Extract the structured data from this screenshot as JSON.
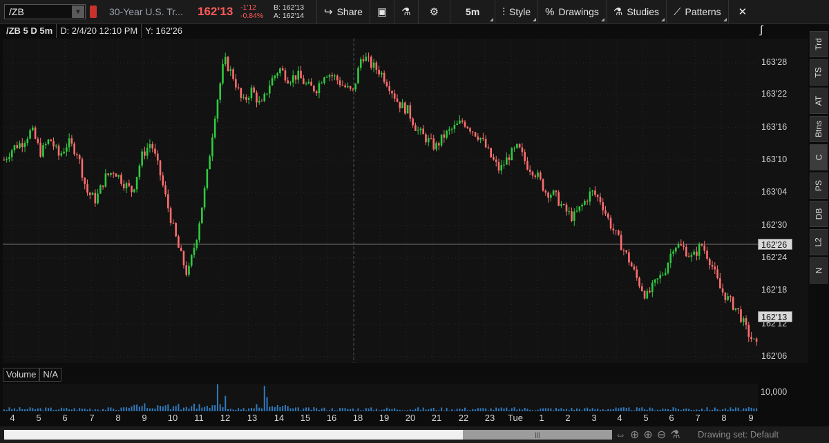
{
  "toolbar": {
    "symbol": "/ZB",
    "description": "30-Year U.S. Tr...",
    "last": "162'13",
    "change": "-1'12",
    "change_pct": "-0.84%",
    "bid": "B: 162'13",
    "ask": "A: 162'14",
    "share": "Share",
    "timeframe": "5m",
    "style": "Style",
    "drawings": "Drawings",
    "studies": "Studies",
    "patterns": "Patterns"
  },
  "chart_header": {
    "symbol_range": "/ZB 5 D 5m",
    "date": "D: 2/4/20 12:10 PM",
    "y": "Y: 162'26"
  },
  "price_axis": {
    "ticks": [
      "163'28",
      "163'22",
      "163'16",
      "163'10",
      "163'04",
      "162'30",
      "162'24",
      "162'18",
      "162'12",
      "162'06"
    ],
    "crosshair_label": "162'26",
    "last_label": "162'13"
  },
  "volume": {
    "label": "Volume",
    "value": "N/A",
    "tick": "10,000"
  },
  "time_axis": [
    "4",
    "5",
    "6",
    "7",
    "8",
    "9",
    "10",
    "11",
    "12",
    "13",
    "14",
    "15",
    "16",
    "18",
    "19",
    "20",
    "21",
    "22",
    "23",
    "Tue",
    "1",
    "2",
    "3",
    "4",
    "5",
    "6",
    "7",
    "8",
    "9"
  ],
  "right_tabs": [
    "Trd",
    "TS",
    "AT",
    "Btns",
    "C",
    "PS",
    "DB",
    "L2",
    "N"
  ],
  "drawing_set": "Drawing set: Default",
  "colors": {
    "up": "#2ecc40",
    "down": "#ff6e6e",
    "background": "#121212",
    "accent": "#ff5a5a"
  },
  "chart_data": {
    "type": "candlestick",
    "series_name": "/ZB 5 D 5m",
    "price_ticks": [
      "163'28",
      "163'22",
      "163'16",
      "163'10",
      "163'04",
      "162'30",
      "162'24",
      "162'18",
      "162'12",
      "162'06"
    ],
    "ylim": [
      162.125,
      163.96875
    ],
    "close_path": [
      163.28,
      163.35,
      163.38,
      163.45,
      163.32,
      163.4,
      163.3,
      163.38,
      163.32,
      163.1,
      163.05,
      163.18,
      163.22,
      163.15,
      163.1,
      163.3,
      163.38,
      163.2,
      162.98,
      162.78,
      162.62,
      162.85,
      163.15,
      163.55,
      163.85,
      163.75,
      163.6,
      163.68,
      163.58,
      163.72,
      163.8,
      163.74,
      163.76,
      163.7,
      163.68,
      163.78,
      163.75,
      163.7,
      163.66,
      163.88,
      163.82,
      163.78,
      163.7,
      163.6,
      163.56,
      163.45,
      163.4,
      163.35,
      163.42,
      163.46,
      163.5,
      163.45,
      163.4,
      163.3,
      163.22,
      163.3,
      163.35,
      163.25,
      163.2,
      163.1,
      163.08,
      163.0,
      162.95,
      163.02,
      163.1,
      163.05,
      162.92,
      162.82,
      162.72,
      162.6,
      162.5,
      162.58,
      162.65,
      162.8,
      162.78,
      162.72,
      162.8,
      162.7,
      162.55,
      162.48,
      162.42,
      162.3,
      162.22
    ]
  }
}
